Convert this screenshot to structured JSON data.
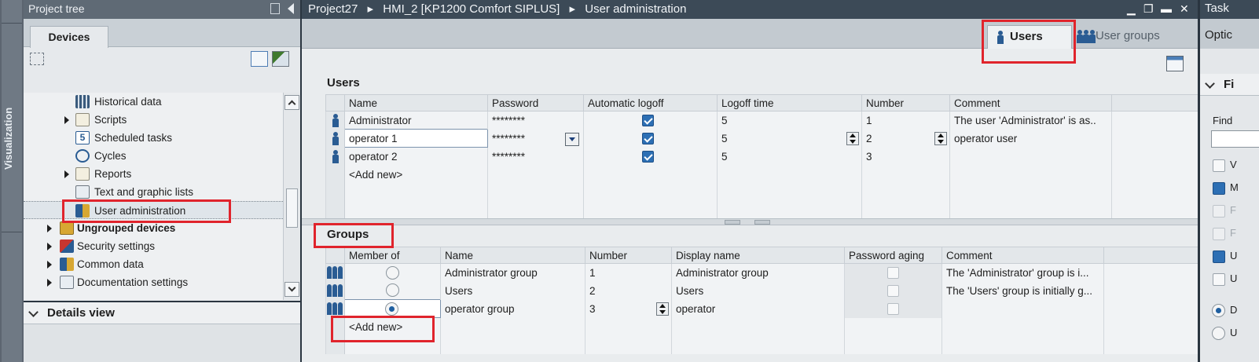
{
  "vertical_tab": {
    "label": "Visualization"
  },
  "project_tree": {
    "title": "Project tree",
    "tab": "Devices",
    "items": [
      {
        "label": "Historical data",
        "icon": "historical-data-icon"
      },
      {
        "label": "Scripts",
        "icon": "scripts-icon"
      },
      {
        "label": "Scheduled tasks",
        "icon": "scheduled-tasks-icon"
      },
      {
        "label": "Cycles",
        "icon": "cycles-icon"
      },
      {
        "label": "Reports",
        "icon": "reports-icon"
      },
      {
        "label": "Text and graphic lists",
        "icon": "text-graphic-lists-icon"
      },
      {
        "label": "User administration",
        "icon": "user-administration-icon"
      },
      {
        "label": "Ungrouped devices",
        "icon": "ungrouped-devices-icon"
      },
      {
        "label": "Security settings",
        "icon": "security-settings-icon"
      },
      {
        "label": "Common data",
        "icon": "common-data-icon"
      },
      {
        "label": "Documentation settings",
        "icon": "documentation-settings-icon"
      }
    ]
  },
  "details_view": {
    "title": "Details view"
  },
  "editor": {
    "breadcrumb": [
      "Project27",
      "HMI_2 [KP1200 Comfort SIPLUS]",
      "User administration"
    ],
    "tabs": {
      "users": "Users",
      "user_groups": "User groups"
    },
    "users_section": {
      "title": "Users",
      "columns": [
        "Name",
        "Password",
        "Automatic logoff",
        "Logoff time",
        "Number",
        "Comment"
      ],
      "rows": [
        {
          "name": "Administrator",
          "password": "********",
          "auto_logoff": true,
          "logoff_time": "5",
          "number": "1",
          "comment": "The user 'Administrator' is as.."
        },
        {
          "name": "operator 1",
          "password": "********",
          "auto_logoff": true,
          "logoff_time": "5",
          "number": "2",
          "comment": "operator user"
        },
        {
          "name": "operator 2",
          "password": "********",
          "auto_logoff": true,
          "logoff_time": "5",
          "number": "3",
          "comment": ""
        }
      ],
      "add_new": "<Add new>"
    },
    "groups_section": {
      "title": "Groups",
      "columns": [
        "Member of",
        "Name",
        "Number",
        "Display name",
        "Password aging",
        "Comment"
      ],
      "rows": [
        {
          "member": false,
          "name": "Administrator group",
          "number": "1",
          "display_name": "Administrator group",
          "password_aging": false,
          "comment": "The 'Administrator' group is i..."
        },
        {
          "member": false,
          "name": "Users",
          "number": "2",
          "display_name": "Users",
          "password_aging": false,
          "comment": "The 'Users' group is initially g..."
        },
        {
          "member": true,
          "name": "operator group",
          "number": "3",
          "display_name": "operator",
          "password_aging": false,
          "comment": ""
        }
      ],
      "add_new": "<Add new>"
    }
  },
  "task_panel": {
    "title": "Task",
    "tab": "Optic",
    "section_letter": "Fi",
    "find_label": "Find",
    "checkbox_letters": [
      "V",
      "M",
      "F",
      "F",
      "U",
      "U"
    ],
    "checkbox_states": [
      false,
      true,
      false,
      false,
      true,
      false
    ],
    "radio_letters": [
      "D",
      "U"
    ],
    "radio_states": [
      true,
      false
    ]
  },
  "colors": {
    "highlight_red": "#e0242c",
    "header_dark": "#3c4a57",
    "accent_blue": "#2d6fb4"
  }
}
